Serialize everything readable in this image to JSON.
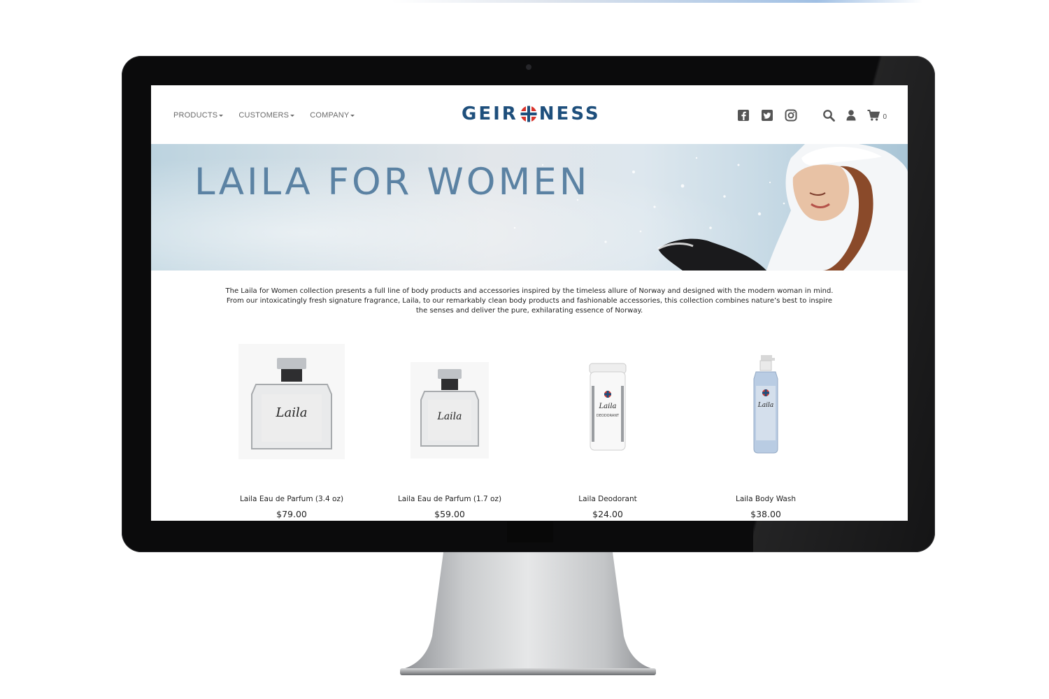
{
  "nav": {
    "menu": [
      {
        "label": "PRODUCTS"
      },
      {
        "label": "CUSTOMERS"
      },
      {
        "label": "COMPANY"
      }
    ],
    "logo_left": "GEIR",
    "logo_right": "NESS",
    "icons": [
      "facebook-icon",
      "twitter-icon",
      "instagram-icon",
      "search-icon",
      "user-icon",
      "cart-icon"
    ],
    "cart_count": "0"
  },
  "banner": {
    "title": "LAILA FOR WOMEN"
  },
  "intro": {
    "text": "The Laila for Women collection presents a full line of body products and accessories inspired by the timeless allure of Norway and designed with the modern woman in mind. From our intoxicatingly fresh signature fragrance, Laila, to our remarkably clean body products and fashionable accessories, this collection combines nature’s best to inspire the senses and deliver the pure, exhilarating essence of Norway."
  },
  "products": [
    {
      "name": "Laila Eau de Parfum (3.4 oz)",
      "price": "$79.00"
    },
    {
      "name": "Laila Eau de Parfum (1.7 oz)",
      "price": "$59.00"
    },
    {
      "name": "Laila Deodorant",
      "price": "$24.00"
    },
    {
      "name": "Laila Body Wash",
      "price": "$38.00"
    }
  ],
  "label_art": {
    "brand_script": "Laila",
    "deodorant_label": "DEODORANT"
  },
  "colors": {
    "brand_blue": "#1e4f7c",
    "banner_title": "#5b82a3",
    "flag_red": "#d9342b"
  }
}
